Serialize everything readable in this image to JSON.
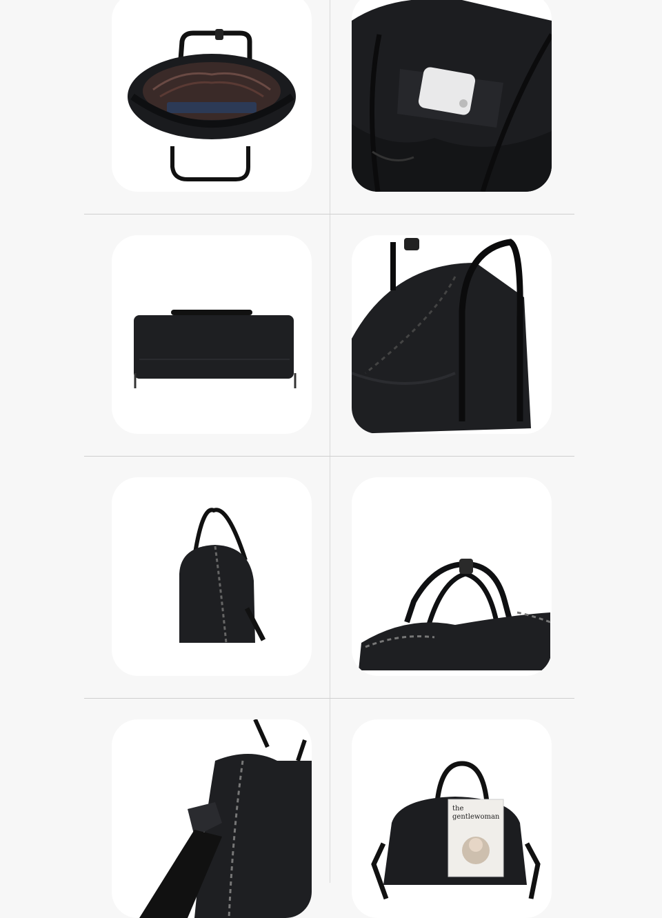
{
  "gallery": {
    "background": "#f7f7f7",
    "tile_background": "#ffffff",
    "product_color": "#17181b",
    "tiles": [
      {
        "view": "open-top-interior"
      },
      {
        "view": "front-pocket-with-phone"
      },
      {
        "view": "bottom-base"
      },
      {
        "view": "drawstring-closeup"
      },
      {
        "view": "side-profile"
      },
      {
        "view": "handles-top"
      },
      {
        "view": "side-strap-closeup"
      },
      {
        "view": "front-with-magazine"
      }
    ]
  },
  "magazine": {
    "line1": "the",
    "line2": "gentlewoman"
  }
}
